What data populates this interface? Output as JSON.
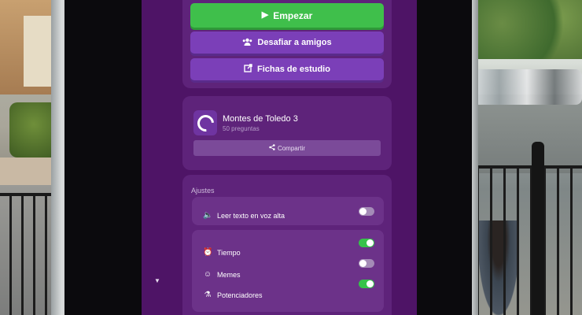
{
  "buttons": {
    "start_label": "Empezar",
    "challenge_label": "Desafiar a amigos",
    "flashcards_label": "Fichas de estudio"
  },
  "quiz": {
    "title": "Montes de Toledo 3",
    "subtitle": "50 preguntas",
    "share_label": "Compartir"
  },
  "settings": {
    "heading": "Ajustes",
    "read_aloud": {
      "label": "Leer texto en voz alta",
      "enabled": false
    },
    "options": [
      {
        "label": "Tiempo",
        "icon": "alarm-clock-icon",
        "enabled": true
      },
      {
        "label": "Memes",
        "icon": "meme-face-icon",
        "enabled": false
      },
      {
        "label": "Potenciadores",
        "icon": "flask-icon",
        "enabled": true
      }
    ]
  },
  "colors": {
    "screen_bg": "#4e1466",
    "panel_bg": "#5e237a",
    "start_button": "#3fbf4b",
    "secondary_button": "#7b3fb8",
    "toggle_on": "#37c24a",
    "toggle_off": "#a48bb7"
  }
}
